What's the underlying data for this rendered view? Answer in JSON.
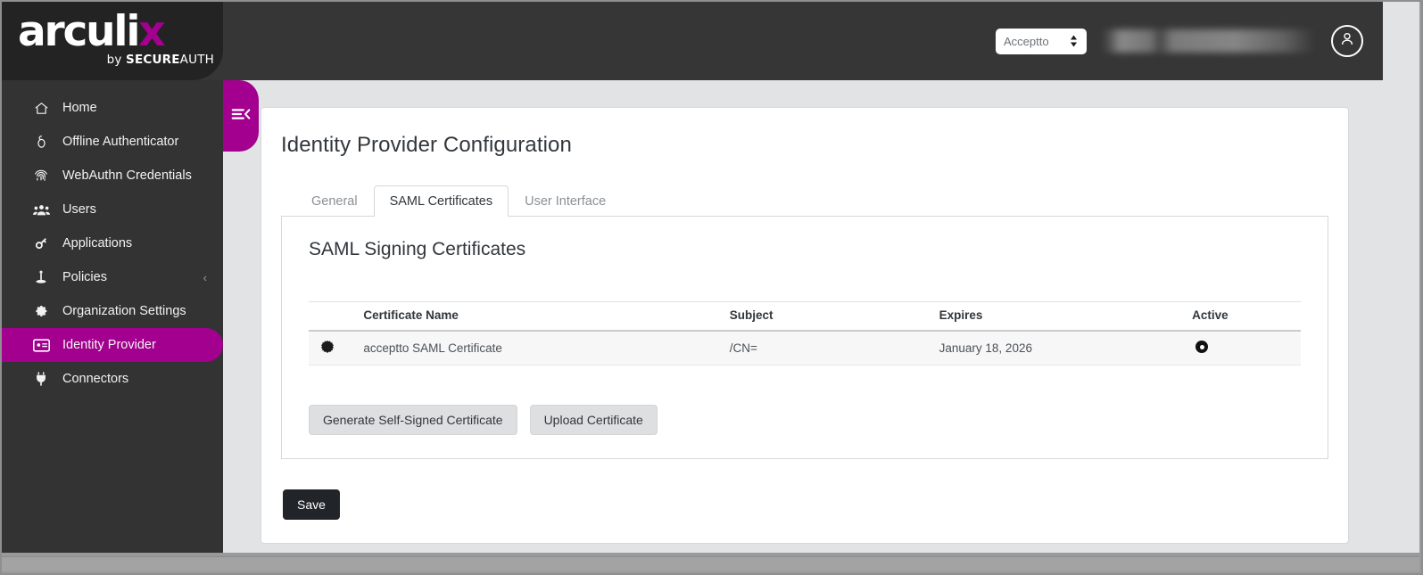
{
  "brand": {
    "logo_main": "arculi",
    "logo_accent": "x",
    "logo_by": "by ",
    "logo_secure": "SECURE",
    "logo_auth": "AUTH",
    "accent_color": "#a3008f",
    "header_bg": "#363636",
    "sidebar_bg": "#333333"
  },
  "header": {
    "org_select": {
      "value": "Acceptto",
      "icon": "select-updown-icon"
    },
    "user_label": "",
    "avatar_icon": "user-avatar-icon"
  },
  "sidebar": {
    "collapse_icon": "collapse-sidebar-icon",
    "items": [
      {
        "label": "Home",
        "icon": "home-icon",
        "active": false,
        "chevron": ""
      },
      {
        "label": "Offline Authenticator",
        "icon": "offline-authenticator-icon",
        "active": false,
        "chevron": ""
      },
      {
        "label": "WebAuthn Credentials",
        "icon": "fingerprint-icon",
        "active": false,
        "chevron": ""
      },
      {
        "label": "Users",
        "icon": "users-icon",
        "active": false,
        "chevron": ""
      },
      {
        "label": "Applications",
        "icon": "key-icon",
        "active": false,
        "chevron": ""
      },
      {
        "label": "Policies",
        "icon": "policies-icon",
        "active": false,
        "chevron": "‹"
      },
      {
        "label": "Organization Settings",
        "icon": "gear-icon",
        "active": false,
        "chevron": ""
      },
      {
        "label": "Identity Provider",
        "icon": "id-card-icon",
        "active": true,
        "chevron": ""
      },
      {
        "label": "Connectors",
        "icon": "plug-icon",
        "active": false,
        "chevron": ""
      }
    ]
  },
  "main": {
    "page_title": "Identity Provider Configuration",
    "tabs": [
      {
        "label": "General",
        "active": false
      },
      {
        "label": "SAML Certificates",
        "active": true
      },
      {
        "label": "User Interface",
        "active": false
      }
    ],
    "panel": {
      "title": "SAML Signing Certificates",
      "table": {
        "columns": [
          "",
          "Certificate Name",
          "Subject",
          "Expires",
          "Active"
        ],
        "rows": [
          {
            "icon": "certificate-seal-icon",
            "certificate_name": "acceptto SAML Certificate",
            "subject": "/CN=",
            "expires": "January 18, 2026",
            "active": true,
            "active_icon": "radio-selected-icon"
          }
        ]
      },
      "buttons": [
        {
          "label": "Generate Self-Signed Certificate",
          "style": "gray"
        },
        {
          "label": "Upload Certificate",
          "style": "gray"
        }
      ]
    },
    "save_label": "Save"
  }
}
